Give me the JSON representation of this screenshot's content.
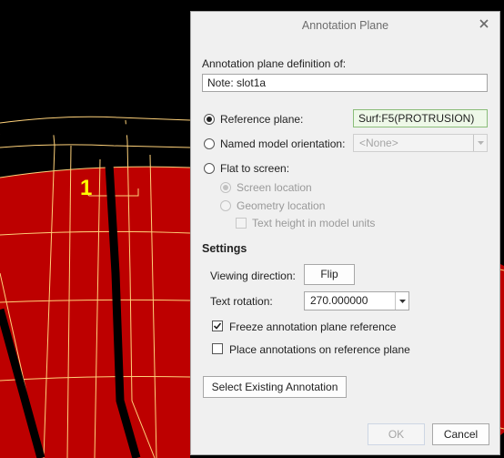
{
  "viewport": {
    "label": "1",
    "colors": {
      "background": "#000000",
      "surface": "#bd0000",
      "edge": "#ffd27a",
      "label": "#ffff00"
    }
  },
  "dialog": {
    "title": "Annotation Plane",
    "definition_label": "Annotation plane definition of:",
    "definition_value": "Note: slot1a",
    "reference_plane": {
      "label": "Reference plane:",
      "value": "Surf:F5(PROTRUSION)",
      "selected": true
    },
    "named_orientation": {
      "label": "Named model orientation:",
      "value": "<None>",
      "enabled": false
    },
    "flat_to_screen": {
      "label": "Flat to screen:",
      "screen_location": "Screen location",
      "geometry_location": "Geometry location",
      "text_height": "Text height in model units"
    },
    "settings": {
      "heading": "Settings",
      "viewing_direction_label": "Viewing direction:",
      "flip_label": "Flip",
      "text_rotation_label": "Text rotation:",
      "text_rotation_value": "270.000000",
      "freeze_label": "Freeze annotation plane reference",
      "freeze_checked": true,
      "place_label": "Place annotations on reference plane",
      "place_checked": false
    },
    "select_existing_label": "Select Existing Annotation",
    "ok_label": "OK",
    "cancel_label": "Cancel",
    "colors": {
      "dialog_bg": "#f0f0f0",
      "reference_bg": "#eef8e8",
      "disabled_text": "#9a9a9a"
    }
  }
}
